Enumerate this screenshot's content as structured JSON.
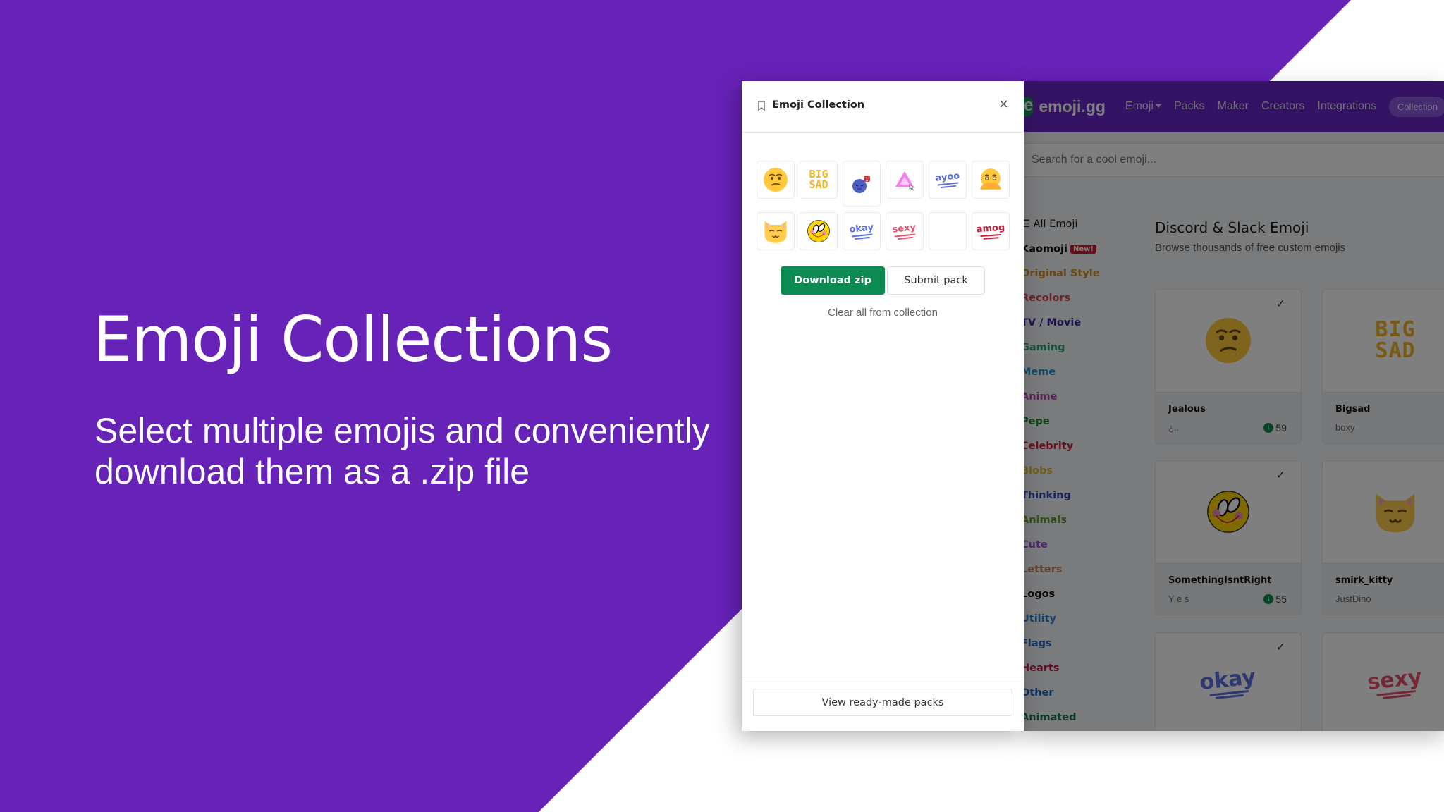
{
  "hero": {
    "title": "Emoji Collections",
    "subtitle": "Select multiple emojis and conveniently download them as a .zip file"
  },
  "site": {
    "logo_letter": "e",
    "logo_text": "emoji.gg",
    "nav": [
      "Emoji",
      "Packs",
      "Maker",
      "Creators",
      "Integrations"
    ],
    "nav_pill": "Collection",
    "search_placeholder": "Search for a cool emoji...",
    "categories": [
      {
        "label": "All Emoji",
        "color": "#222222"
      },
      {
        "label": "Kaomoji",
        "color": "#111111",
        "badge": "New!"
      },
      {
        "label": "Original Style",
        "color": "#d48f1f"
      },
      {
        "label": "Recolors",
        "color": "#d9465c"
      },
      {
        "label": "TV / Movie",
        "color": "#3b2ba5"
      },
      {
        "label": "Gaming",
        "color": "#2fa57c"
      },
      {
        "label": "Meme",
        "color": "#1a93d0"
      },
      {
        "label": "Anime",
        "color": "#b14fb5"
      },
      {
        "label": "Pepe",
        "color": "#1d8f2c"
      },
      {
        "label": "Celebrity",
        "color": "#c4273f"
      },
      {
        "label": "Blobs",
        "color": "#e1b935"
      },
      {
        "label": "Thinking",
        "color": "#3a4cc0"
      },
      {
        "label": "Animals",
        "color": "#5f9e2c"
      },
      {
        "label": "Cute",
        "color": "#9a4fe0"
      },
      {
        "label": "Letters",
        "color": "#c7865a"
      },
      {
        "label": "Logos",
        "color": "#111111"
      },
      {
        "label": "Utility",
        "color": "#2b7fd0"
      },
      {
        "label": "Flags",
        "color": "#2c6fc7"
      },
      {
        "label": "Hearts",
        "color": "#c01a55"
      },
      {
        "label": "Other",
        "color": "#2066b8"
      },
      {
        "label": "Animated",
        "color": "#1f7a55"
      }
    ],
    "main_title": "Discord & Slack Emoji",
    "main_subtitle": "Browse thousands of free custom emojis",
    "cards": [
      {
        "name": "Jealous",
        "author": "¿..",
        "downloads": "59",
        "checked": true,
        "art": "jealous-face"
      },
      {
        "name": "Bigsad",
        "author": "boxy",
        "downloads": "",
        "checked": false,
        "art": "big-sad-text"
      },
      {
        "name": "SomethingIsntRight",
        "author": "Y e s",
        "downloads": "55",
        "checked": true,
        "art": "wonky-face"
      },
      {
        "name": "smirk_kitty",
        "author": "JustDino",
        "downloads": "",
        "checked": false,
        "art": "smirk-cat"
      },
      {
        "name": "",
        "author": "",
        "downloads": "",
        "checked": true,
        "art": "okay-text"
      },
      {
        "name": "",
        "author": "",
        "downloads": "",
        "checked": false,
        "art": "sexy-text"
      }
    ]
  },
  "panel": {
    "title": "Emoji Collection",
    "close_symbol": "×",
    "emojis": [
      {
        "id": "jealous-face"
      },
      {
        "id": "big-sad-text",
        "text": "BIG SAD"
      },
      {
        "id": "angry-ping"
      },
      {
        "id": "pink-triangle"
      },
      {
        "id": "ayoo-text",
        "text": "ayoo"
      },
      {
        "id": "hand-over-mouth"
      },
      {
        "id": "smirk-cat"
      },
      {
        "id": "wonky-face"
      },
      {
        "id": "okay-text",
        "text": "okay"
      },
      {
        "id": "sexy-text",
        "text": "sexy"
      },
      {
        "id": "blank"
      },
      {
        "id": "amog-text",
        "text": "amog"
      }
    ],
    "download_label": "Download zip",
    "submit_label": "Submit pack",
    "clear_label": "Clear all from collection",
    "packs_label": "View ready-made packs",
    "ping_count": "1"
  },
  "colors": {
    "brand_purple": "#6722b8",
    "download_green": "#0b8a52",
    "emoji_yellow": "#ffc83d"
  }
}
